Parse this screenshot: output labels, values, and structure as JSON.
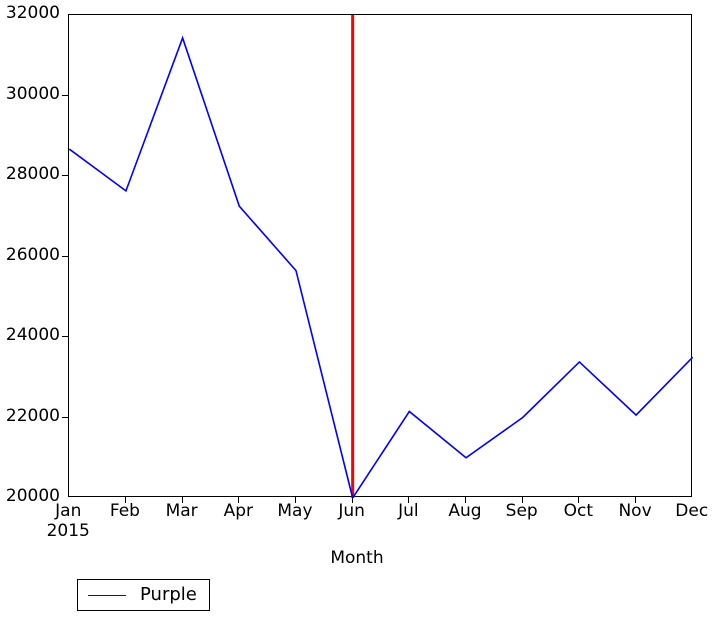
{
  "chart_data": {
    "type": "line",
    "title": "",
    "subtitle": "",
    "xlabel": "Month",
    "ylabel": "",
    "categories": [
      "Jan",
      "Feb",
      "Mar",
      "Apr",
      "May",
      "Jun",
      "Jul",
      "Aug",
      "Sep",
      "Oct",
      "Nov",
      "Dec"
    ],
    "x_sub_label": "2015",
    "series": [
      {
        "name": "Purple",
        "color": "#0000ff",
        "values": [
          28670,
          27630,
          31430,
          27250,
          25650,
          20000,
          22150,
          21000,
          22000,
          23380,
          22060,
          23500
        ]
      }
    ],
    "annotations": [
      {
        "type": "vertical-line",
        "at_category": "Jun",
        "color": "#ff0000",
        "linewidth": 3
      }
    ],
    "xlim": [
      0,
      11
    ],
    "ylim": [
      20000,
      32000
    ],
    "ytick_labels": [
      "20000",
      "22000",
      "24000",
      "26000",
      "28000",
      "30000",
      "32000"
    ],
    "ytick_values": [
      20000,
      22000,
      24000,
      26000,
      28000,
      30000,
      32000
    ],
    "grid": false,
    "legend": {
      "position": "below-left",
      "entries": [
        {
          "label": "Purple",
          "color": "#0000ff"
        }
      ]
    }
  }
}
